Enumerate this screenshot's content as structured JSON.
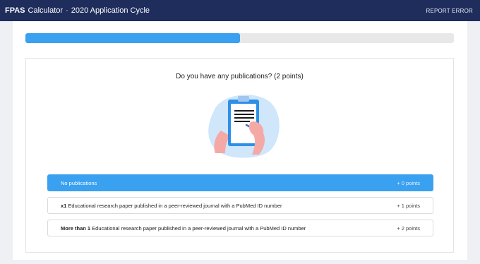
{
  "header": {
    "brand_bold": "FPAS",
    "brand_rest": "Calculator",
    "separator": "·",
    "cycle": "2020 Application Cycle",
    "report_label": "REPORT ERROR"
  },
  "progress": {
    "fraction": 0.5
  },
  "question": {
    "text": "Do you have any publications? (2 points)"
  },
  "options": [
    {
      "prefix": "",
      "label": "No publications",
      "points": "+ 0 points",
      "selected": true
    },
    {
      "prefix": "x1",
      "label": " Educational research paper published in a peer-reviewed journal with a PubMed ID number",
      "points": "+ 1 points",
      "selected": false
    },
    {
      "prefix": "More than 1",
      "label": " Educational research paper published in a peer-reviewed journal with a PubMed ID number",
      "points": "+ 2 points",
      "selected": false
    }
  ],
  "colors": {
    "header_bg": "#1f2d5c",
    "accent": "#3aa0f0"
  }
}
